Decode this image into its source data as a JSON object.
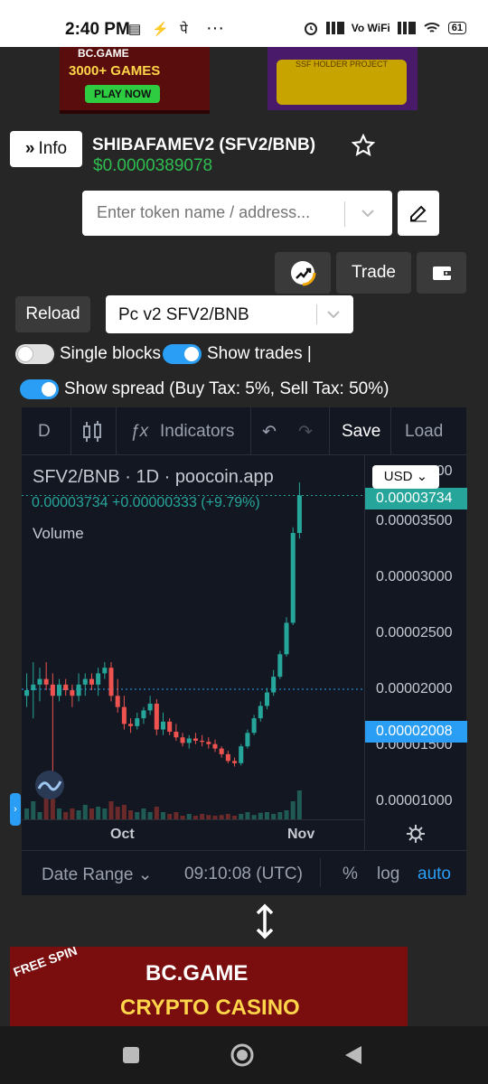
{
  "status_bar": {
    "time": "2:40 PM",
    "indicators": "▤ ⚡ पे",
    "more": "···",
    "network": "Vo WiFi",
    "battery": "61"
  },
  "ads": {
    "top_left": {
      "brand": "BC.GAME",
      "headline": "3000+ GAMES",
      "cta": "PLAY NOW"
    },
    "top_right": {
      "text": "SSF HOLDER PROJECT"
    },
    "bottom": {
      "badge": "FREE SPIN",
      "brand": "BC.GAME",
      "tagline": "CRYPTO CASINO"
    }
  },
  "header": {
    "info_label": "Info",
    "token_title": "SHIBAFAMEV2 (SFV2/BNB)",
    "token_price": "$0.0000389078"
  },
  "search": {
    "placeholder": "Enter token name / address..."
  },
  "actions": {
    "trade_label": "Trade",
    "reload_label": "Reload"
  },
  "pair_select": {
    "value": "Pc v2 SFV2/BNB"
  },
  "toggles": [
    {
      "label": "Single blocks",
      "on": false
    },
    {
      "label": "Show trades |",
      "on": true
    },
    {
      "label": "Show spread (Buy Tax: 5%, Sell Tax: 50%)",
      "on": true
    }
  ],
  "chart": {
    "toolbar": {
      "interval": "D",
      "indicators": "Indicators",
      "save": "Save",
      "load": "Load"
    },
    "legend": {
      "symbol": "SFV2/BNB · 1D · poocoin.app",
      "values": "0.00003734  +0.00000333 (+9.79%)",
      "volume": "Volume"
    },
    "currency": "USD",
    "last_price": "0.00003734",
    "marked_price": "0.00002008",
    "top_price_label": "0.00004000",
    "bottom": {
      "date_range": "Date Range",
      "clock": "09:10:08 (UTC)",
      "pct": "%",
      "log": "log",
      "auto": "auto"
    },
    "colors": {
      "up": "#26a69a",
      "down": "#ef5350",
      "accent": "#2a9df4"
    }
  },
  "chart_data": {
    "type": "candlestick",
    "title": "SFV2/BNB · 1D · poocoin.app",
    "x_ticks": [
      "Oct",
      "Nov"
    ],
    "y_ticks": [
      1e-05,
      1.5e-05,
      2e-05,
      2.5e-05,
      3e-05,
      3.5e-05
    ],
    "ylim": [
      8.5e-06,
      4.1e-05
    ],
    "candles": [
      {
        "o": 1.95e-05,
        "h": 2.15e-05,
        "l": 1.85e-05,
        "c": 2e-05
      },
      {
        "o": 2e-05,
        "h": 2.25e-05,
        "l": 1.75e-05,
        "c": 2.05e-05
      },
      {
        "o": 2.05e-05,
        "h": 2.2e-05,
        "l": 1.9e-05,
        "c": 2.1e-05
      },
      {
        "o": 2.1e-05,
        "h": 2.25e-05,
        "l": 2e-05,
        "c": 2.05e-05
      },
      {
        "o": 2.05e-05,
        "h": 2.15e-05,
        "l": 1.2e-05,
        "c": 1.95e-05
      },
      {
        "o": 1.95e-05,
        "h": 2.1e-05,
        "l": 1.9e-05,
        "c": 2.05e-05
      },
      {
        "o": 2.05e-05,
        "h": 2.1e-05,
        "l": 1.95e-05,
        "c": 2e-05
      },
      {
        "o": 2e-05,
        "h": 2.05e-05,
        "l": 1.85e-05,
        "c": 1.95e-05
      },
      {
        "o": 1.95e-05,
        "h": 2.15e-05,
        "l": 1.9e-05,
        "c": 2.05e-05
      },
      {
        "o": 2.05e-05,
        "h": 2.15e-05,
        "l": 1.95e-05,
        "c": 2.1e-05
      },
      {
        "o": 2.1e-05,
        "h": 2.15e-05,
        "l": 2e-05,
        "c": 2.05e-05
      },
      {
        "o": 2.05e-05,
        "h": 2.2e-05,
        "l": 1.95e-05,
        "c": 2.15e-05
      },
      {
        "o": 2.15e-05,
        "h": 2.25e-05,
        "l": 2.1e-05,
        "c": 2.2e-05
      },
      {
        "o": 2.2e-05,
        "h": 2.25e-05,
        "l": 1.9e-05,
        "c": 1.95e-05
      },
      {
        "o": 1.95e-05,
        "h": 2.1e-05,
        "l": 1.8e-05,
        "c": 1.85e-05
      },
      {
        "o": 1.85e-05,
        "h": 1.95e-05,
        "l": 1.65e-05,
        "c": 1.7e-05
      },
      {
        "o": 1.7e-05,
        "h": 1.75e-05,
        "l": 1.62e-05,
        "c": 1.68e-05
      },
      {
        "o": 1.68e-05,
        "h": 1.8e-05,
        "l": 1.65e-05,
        "c": 1.75e-05
      },
      {
        "o": 1.75e-05,
        "h": 1.85e-05,
        "l": 1.7e-05,
        "c": 1.82e-05
      },
      {
        "o": 1.82e-05,
        "h": 1.95e-05,
        "l": 1.78e-05,
        "c": 1.88e-05
      },
      {
        "o": 1.88e-05,
        "h": 1.92e-05,
        "l": 1.6e-05,
        "c": 1.65e-05
      },
      {
        "o": 1.65e-05,
        "h": 1.8e-05,
        "l": 1.6e-05,
        "c": 1.72e-05
      },
      {
        "o": 1.72e-05,
        "h": 1.75e-05,
        "l": 1.6e-05,
        "c": 1.63e-05
      },
      {
        "o": 1.63e-05,
        "h": 1.7e-05,
        "l": 1.55e-05,
        "c": 1.58e-05
      },
      {
        "o": 1.58e-05,
        "h": 1.62e-05,
        "l": 1.5e-05,
        "c": 1.53e-05
      },
      {
        "o": 1.53e-05,
        "h": 1.6e-05,
        "l": 1.48e-05,
        "c": 1.57e-05
      },
      {
        "o": 1.57e-05,
        "h": 1.62e-05,
        "l": 1.52e-05,
        "c": 1.55e-05
      },
      {
        "o": 1.55e-05,
        "h": 1.6e-05,
        "l": 1.5e-05,
        "c": 1.54e-05
      },
      {
        "o": 1.54e-05,
        "h": 1.58e-05,
        "l": 1.48e-05,
        "c": 1.52e-05
      },
      {
        "o": 1.52e-05,
        "h": 1.56e-05,
        "l": 1.45e-05,
        "c": 1.48e-05
      },
      {
        "o": 1.48e-05,
        "h": 1.5e-05,
        "l": 1.4e-05,
        "c": 1.43e-05
      },
      {
        "o": 1.43e-05,
        "h": 1.46e-05,
        "l": 1.35e-05,
        "c": 1.37e-05
      },
      {
        "o": 1.37e-05,
        "h": 1.4e-05,
        "l": 1.32e-05,
        "c": 1.35e-05
      },
      {
        "o": 1.35e-05,
        "h": 1.52e-05,
        "l": 1.33e-05,
        "c": 1.5e-05
      },
      {
        "o": 1.5e-05,
        "h": 1.65e-05,
        "l": 1.48e-05,
        "c": 1.62e-05
      },
      {
        "o": 1.62e-05,
        "h": 1.78e-05,
        "l": 1.6e-05,
        "c": 1.75e-05
      },
      {
        "o": 1.75e-05,
        "h": 1.9e-05,
        "l": 1.72e-05,
        "c": 1.86e-05
      },
      {
        "o": 1.86e-05,
        "h": 2.02e-05,
        "l": 1.83e-05,
        "c": 1.98e-05
      },
      {
        "o": 1.98e-05,
        "h": 2.18e-05,
        "l": 1.95e-05,
        "c": 2.12e-05
      },
      {
        "o": 2.12e-05,
        "h": 2.35e-05,
        "l": 2.1e-05,
        "c": 2.32e-05
      },
      {
        "o": 2.32e-05,
        "h": 2.65e-05,
        "l": 2.3e-05,
        "c": 2.6e-05
      },
      {
        "o": 2.6e-05,
        "h": 3.45e-05,
        "l": 2.58e-05,
        "c": 3.4e-05
      },
      {
        "o": 3.4e-05,
        "h": 3.85e-05,
        "l": 3.35e-05,
        "c": 3.734e-05
      }
    ],
    "volume": [
      0.3,
      0.5,
      0.2,
      0.6,
      0.9,
      0.3,
      0.2,
      0.3,
      0.25,
      0.4,
      0.3,
      0.35,
      0.3,
      0.5,
      0.35,
      0.4,
      0.25,
      0.2,
      0.3,
      0.2,
      0.35,
      0.2,
      0.15,
      0.2,
      0.1,
      0.15,
      0.1,
      0.15,
      0.12,
      0.1,
      0.12,
      0.15,
      0.1,
      0.15,
      0.2,
      0.12,
      0.18,
      0.2,
      0.15,
      0.2,
      0.25,
      0.5,
      0.8
    ]
  }
}
